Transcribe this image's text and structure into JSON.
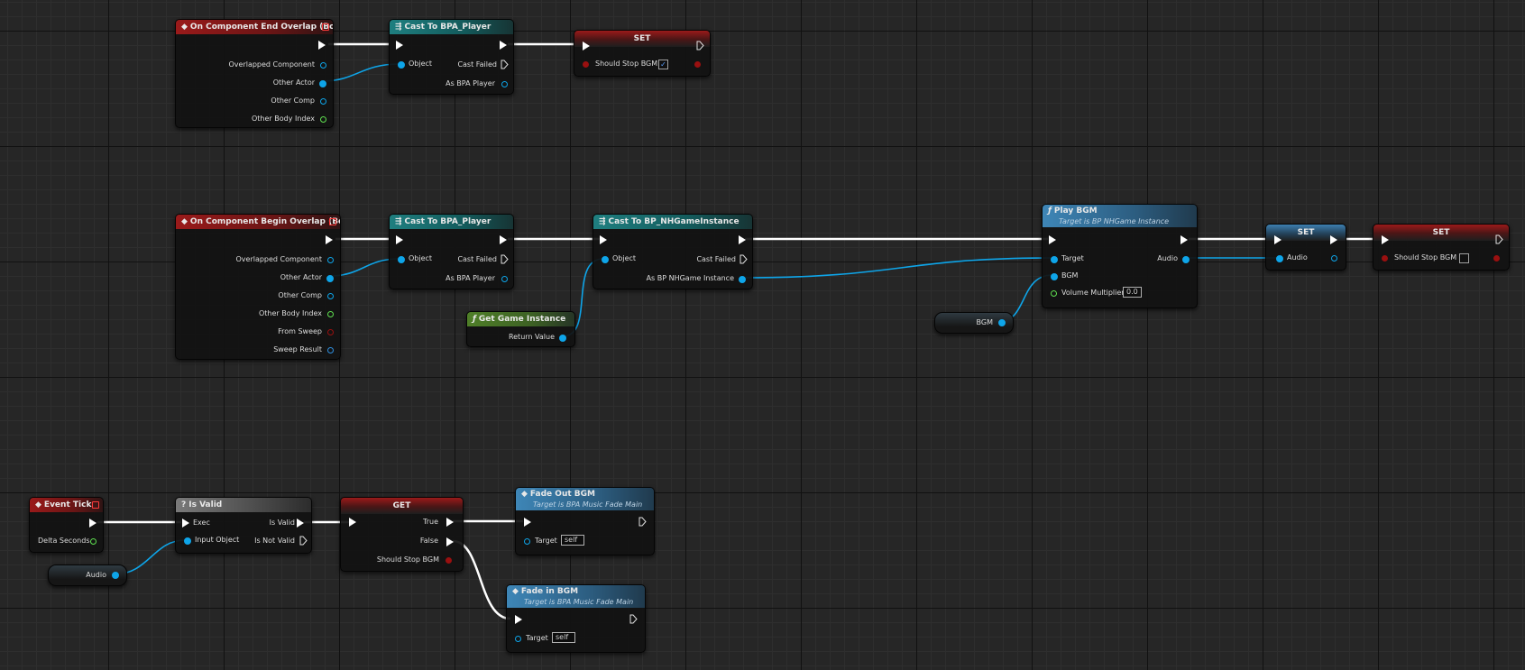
{
  "colors": {
    "background": "#262626",
    "exec_wire": "#ffffff",
    "object_wire": "#0ea5e9",
    "event_header": "#9a1a1a",
    "cast_header": "#1f7f80",
    "pure_function_header": "#4f7f28",
    "function_header": "#3e86b7",
    "macro_header": "#7a7a7a"
  },
  "nodes": {
    "end_overlap": {
      "title": "On Component End Overlap (Box)",
      "pins": [
        "Overlapped Component",
        "Other Actor",
        "Other Comp",
        "Other Body Index"
      ]
    },
    "cast_player_1": {
      "title": "Cast To BPA_Player",
      "in_object": "Object",
      "cast_failed": "Cast Failed",
      "as_output": "As BPA Player"
    },
    "set_stop_1": {
      "title": "SET",
      "var_label": "Should Stop BGM",
      "checked": true,
      "check_glyph": "✓"
    },
    "begin_overlap": {
      "title": "On Component Begin Overlap (Box)",
      "pins": [
        "Overlapped Component",
        "Other Actor",
        "Other Comp",
        "Other Body Index",
        "From Sweep",
        "Sweep Result"
      ]
    },
    "cast_player_2": {
      "title": "Cast To BPA_Player",
      "in_object": "Object",
      "cast_failed": "Cast Failed",
      "as_output": "As BPA Player"
    },
    "cast_game_instance": {
      "title": "Cast To BP_NHGameInstance",
      "in_object": "Object",
      "cast_failed": "Cast Failed",
      "as_output": "As BP NHGame Instance"
    },
    "get_game_instance": {
      "title": "Get Game Instance",
      "return_value": "Return Value"
    },
    "play_bgm": {
      "title": "Play BGM",
      "subtitle": "Target is BP NHGame Instance",
      "target": "Target",
      "audio": "Audio",
      "bgm": "BGM",
      "volume_label": "Volume Multiplier",
      "volume_value": "0.0"
    },
    "bgm_var": {
      "label": "BGM"
    },
    "set_audio": {
      "title": "SET",
      "var_label": "Audio"
    },
    "set_stop_2": {
      "title": "SET",
      "var_label": "Should Stop BGM",
      "checked": false
    },
    "event_tick": {
      "title": "Event Tick",
      "delta": "Delta Seconds"
    },
    "audio_var": {
      "label": "Audio"
    },
    "is_valid": {
      "title": "Is Valid",
      "exec": "Exec",
      "input_object": "Input Object",
      "is_valid": "Is Valid",
      "is_not_valid": "Is Not Valid"
    },
    "get_branch": {
      "title": "GET",
      "true_label": "True",
      "false_label": "False",
      "var_label": "Should Stop BGM"
    },
    "fade_out": {
      "title": "Fade Out BGM",
      "subtitle": "Target is BPA Music Fade Main",
      "target": "Target",
      "target_value": "self"
    },
    "fade_in": {
      "title": "Fade in BGM",
      "subtitle": "Target is BPA Music Fade Main",
      "target": "Target",
      "target_value": "self"
    }
  },
  "icons": {
    "event": "diamond-icon",
    "cast": "cast-arrows-icon",
    "function": "function-f-icon",
    "macro": "question-icon"
  }
}
